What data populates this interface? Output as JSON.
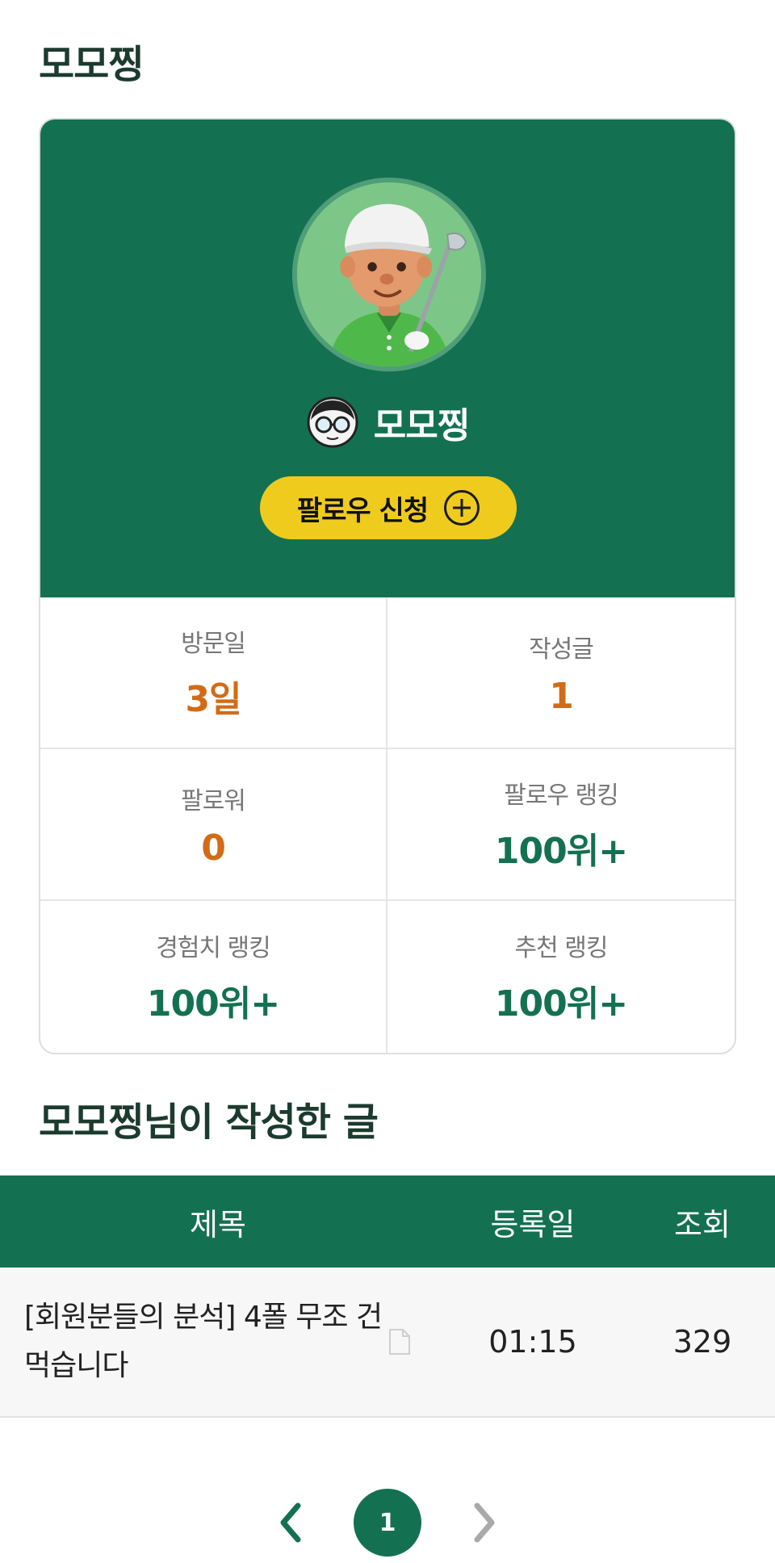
{
  "header": {
    "title": "모모찡"
  },
  "profile": {
    "name": "모모찡",
    "follow_button": "팔로우 신청",
    "stats": [
      {
        "label": "방문일",
        "value": "3일",
        "color": "#d36b16"
      },
      {
        "label": "작성글",
        "value": "1",
        "color": "#d36b16"
      },
      {
        "label": "팔로워",
        "value": "0",
        "color": "#d36b16"
      },
      {
        "label": "팔로우 랭킹",
        "value": "100위+",
        "color": "#137151"
      },
      {
        "label": "경험치 랭킹",
        "value": "100위+",
        "color": "#137151"
      },
      {
        "label": "추천 랭킹",
        "value": "100위+",
        "color": "#137151"
      }
    ]
  },
  "posts": {
    "section_title": "모모찡님이 작성한 글",
    "columns": [
      "제목",
      "등록일",
      "조회"
    ],
    "rows": [
      {
        "title": "[회원분들의 분석] 4폴 무조 건먹습니다",
        "date": "01:15",
        "views": "329"
      }
    ]
  },
  "pagination": {
    "current": "1"
  },
  "colors": {
    "brand_green": "#137151",
    "accent_yellow": "#efcb1d",
    "stat_orange": "#d36b16"
  },
  "icons": [
    "golfer-avatar",
    "level-badge-icon",
    "plus-circle-icon",
    "document-icon",
    "chevron-left-icon",
    "chevron-right-icon"
  ]
}
